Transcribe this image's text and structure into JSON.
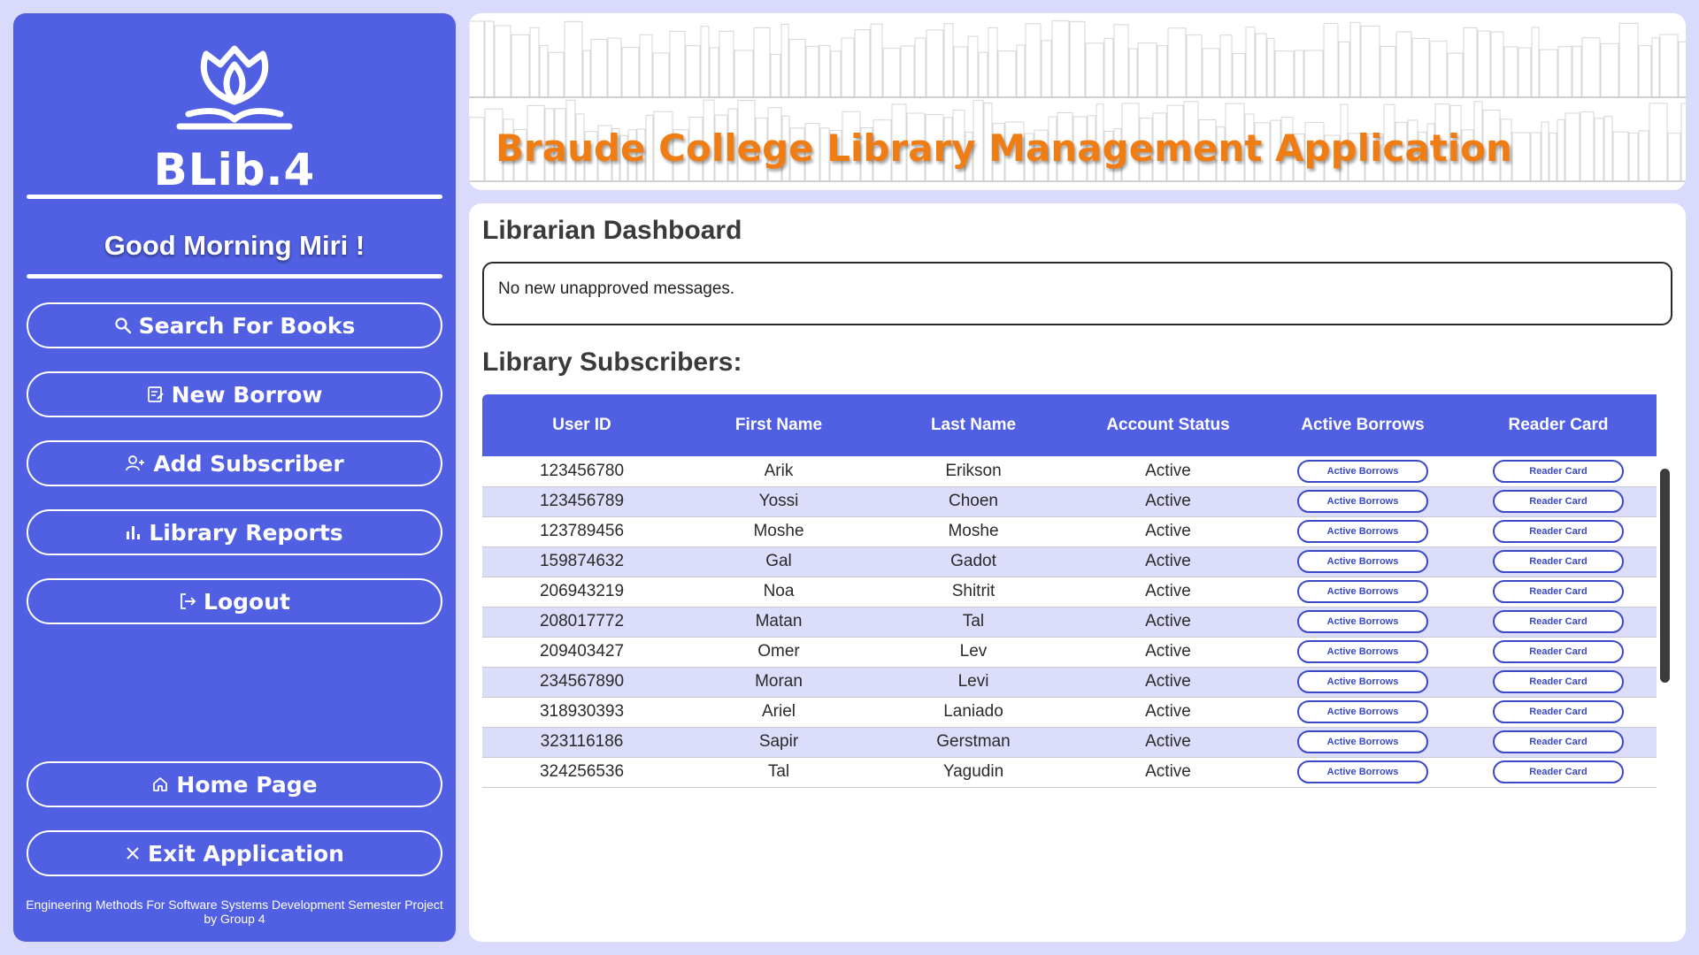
{
  "sidebar": {
    "logo_text": "BLib.4",
    "greeting": "Good Morning Miri !",
    "nav": [
      {
        "label": "Search For Books",
        "icon": "search-icon"
      },
      {
        "label": "New Borrow",
        "icon": "note-edit-icon"
      },
      {
        "label": "Add Subscriber",
        "icon": "add-user-icon"
      },
      {
        "label": "Library Reports",
        "icon": "bar-chart-icon"
      },
      {
        "label": "Logout",
        "icon": "logout-icon"
      }
    ],
    "bottom_nav": [
      {
        "label": "Home Page",
        "icon": "home-icon"
      },
      {
        "label": "Exit Application",
        "icon": "close-icon"
      }
    ],
    "footer_line1": "Engineering Methods For Software Systems Development Semester Project",
    "footer_line2": "by Group 4"
  },
  "header": {
    "title": "Braude College Library Management Application"
  },
  "main": {
    "dashboard_title": "Librarian Dashboard",
    "message": "No new unapproved messages.",
    "subscribers_title": "Library Subscribers:",
    "columns": [
      "User ID",
      "First Name",
      "Last Name",
      "Account Status",
      "Active Borrows",
      "Reader Card"
    ],
    "active_borrows_label": "Active Borrows",
    "reader_card_label": "Reader Card",
    "rows": [
      {
        "id": "123456780",
        "first": "Arik",
        "last": "Erikson",
        "status": "Active"
      },
      {
        "id": "123456789",
        "first": "Yossi",
        "last": "Choen",
        "status": "Active"
      },
      {
        "id": "123789456",
        "first": "Moshe",
        "last": "Moshe",
        "status": "Active"
      },
      {
        "id": "159874632",
        "first": "Gal",
        "last": "Gadot",
        "status": "Active"
      },
      {
        "id": "206943219",
        "first": "Noa",
        "last": "Shitrit",
        "status": "Active"
      },
      {
        "id": "208017772",
        "first": "Matan",
        "last": "Tal",
        "status": "Active"
      },
      {
        "id": "209403427",
        "first": "Omer",
        "last": "Lev",
        "status": "Active"
      },
      {
        "id": "234567890",
        "first": "Moran",
        "last": "Levi",
        "status": "Active"
      },
      {
        "id": "318930393",
        "first": "Ariel",
        "last": "Laniado",
        "status": "Active"
      },
      {
        "id": "323116186",
        "first": "Sapir",
        "last": "Gerstman",
        "status": "Active"
      },
      {
        "id": "324256536",
        "first": "Tal",
        "last": "Yagudin",
        "status": "Active"
      }
    ]
  },
  "colors": {
    "primary": "#5160e3",
    "background": "#d9dafc",
    "title_orange": "#f07c14",
    "row_alt": "#dcdcfb"
  }
}
